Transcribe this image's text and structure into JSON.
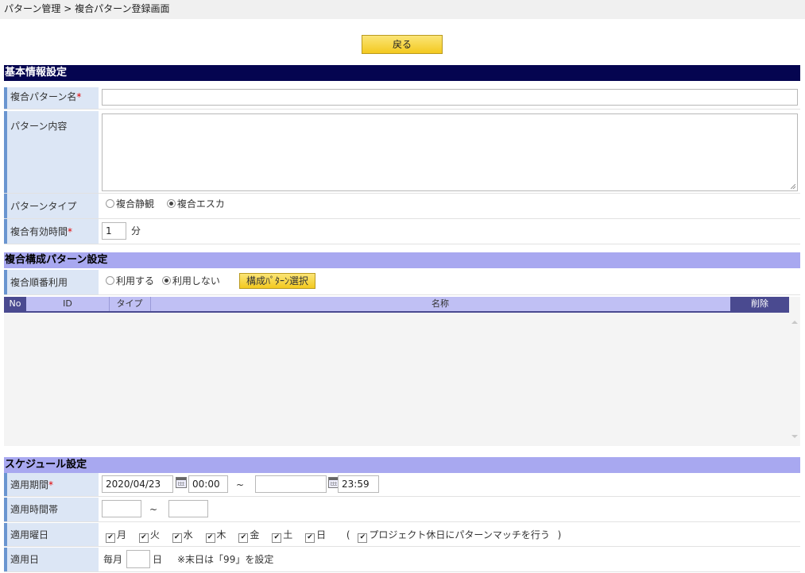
{
  "breadcrumb": "パターン管理 > 複合パターン登録画面",
  "back_label": "戻る",
  "basic": {
    "title": "基本情報設定",
    "name_label": "複合パターン名",
    "name_value": "",
    "content_label": "パターン内容",
    "content_value": "",
    "type_label": "パターンタイプ",
    "type_options": [
      "複合静観",
      "複合エスカ"
    ],
    "type_selected": "複合エスカ",
    "valid_label": "複合有効時間",
    "valid_value": "1",
    "valid_unit": "分"
  },
  "composite": {
    "title": "複合構成パターン設定",
    "order_label": "複合順番利用",
    "order_options": [
      "利用する",
      "利用しない"
    ],
    "order_selected": "利用しない",
    "select_button": "構成ﾊﾟﾀｰﾝ選択",
    "columns": [
      "No",
      "ID",
      "タイプ",
      "名称",
      "削除"
    ],
    "rows": []
  },
  "schedule": {
    "title": "スケジュール設定",
    "period_label": "適用期間",
    "start_date": "2020/04/23",
    "start_time": "00:00",
    "tilde": "~",
    "end_date": "",
    "end_time": "23:59",
    "timeband_label": "適用時間帯",
    "timeband_from": "",
    "timeband_to": "",
    "weekday_label": "適用曜日",
    "weekdays": [
      "月",
      "火",
      "水",
      "木",
      "金",
      "土",
      "日"
    ],
    "weekdays_checked": [
      true,
      true,
      true,
      true,
      true,
      true,
      true
    ],
    "holiday_open": "(",
    "holiday_text": "プロジェクト休日にパターンマッチを行う",
    "holiday_close": ")",
    "holiday_checked": true,
    "day_label": "適用日",
    "day_prefix": "毎月",
    "day_value": "",
    "day_suffix": "日",
    "day_note": "※末日は「99」を設定"
  },
  "required_mark": "*",
  "check_mark": "✔",
  "colors": {
    "section_dark": "#050550",
    "section_light": "#a8a8f0",
    "label_bg": "#dce6f5",
    "required": "#e00000",
    "button": "#f3c91f"
  }
}
